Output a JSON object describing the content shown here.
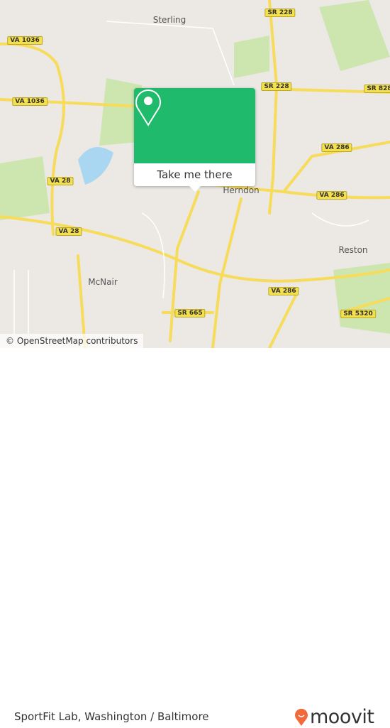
{
  "map": {
    "places": [
      {
        "name": "Sterling"
      },
      {
        "name": "Herndon"
      },
      {
        "name": "Reston"
      },
      {
        "name": "McNair"
      }
    ],
    "shields": [
      "SR 228",
      "VA 1036",
      "SR 228",
      "SR 828",
      "VA 1036",
      "VA 286",
      "VA 286",
      "VA 28",
      "VA 28",
      "VA 286",
      "SR 665",
      "SR 5320"
    ],
    "attribution": "© OpenStreetMap contributors",
    "colors": {
      "land": "#ece8e4",
      "park": "#cde6b0",
      "water": "#a9d6f0",
      "road": "#f6dc5a",
      "popup": "#1fba6b",
      "brand": "#f26a3c"
    }
  },
  "popup": {
    "icon": "map-pin-icon",
    "button_label": "Take me there"
  },
  "footer": {
    "place_title": "SportFit Lab, Washington / Baltimore",
    "logo_text": "moovit"
  }
}
